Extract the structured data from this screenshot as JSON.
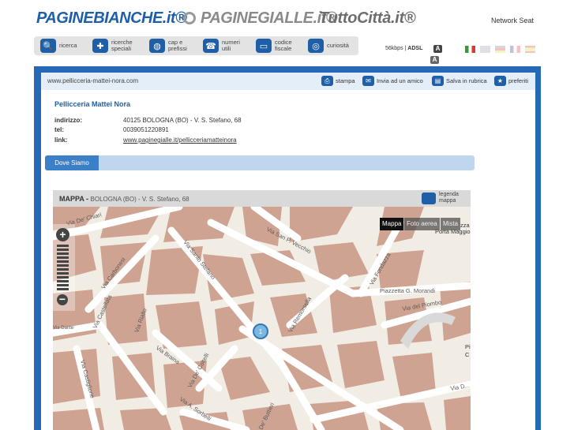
{
  "logos": {
    "paginebianche": "PAGINEBIANCHE.it®",
    "paginegialle": "PAGINEGIALLE.it®",
    "tuttocitta": "TuttoCittà.it®"
  },
  "network_link": "Network Seat",
  "nav": [
    {
      "label": "ricerca",
      "icon": "search-icon"
    },
    {
      "label": "ricerche\nspeciali",
      "icon": "puzzle-icon"
    },
    {
      "label": "cap e\nprefissi",
      "icon": "globe-icon"
    },
    {
      "label": "numeri\nutili",
      "icon": "phone-icon"
    },
    {
      "label": "codice\nfiscale",
      "icon": "id-card-icon"
    },
    {
      "label": "curiosità",
      "icon": "curiosity-icon"
    }
  ],
  "speed": {
    "text": "56kbps",
    "adsl": "ADSL",
    "badge": "A"
  },
  "url": "www.pellicceria-mattei-nora.com",
  "tools": {
    "print": "stampa",
    "send": "Invia ad un amico",
    "save": "Salva in rubrica",
    "favorites": "preferiti"
  },
  "business": {
    "name": "Pellicceria Mattei Nora",
    "address_label": "indirizzo:",
    "address": "40125 BOLOGNA (BO) - V. S. Stefano, 68",
    "tel_label": "tel:",
    "tel": "0039051220891",
    "link_label": "link:",
    "link": "www.paginegialle.it/pellicceriamatteinora"
  },
  "tab_label": "Dove Siamo",
  "map": {
    "title": "MAPPA -",
    "address": "BOLOGNA (BO) - V. S. Stefano, 68",
    "legend": "legenda\nmappa",
    "types": [
      "Mappa",
      "Foto aerea",
      "Mista"
    ],
    "marker": "1",
    "streets": {
      "chiari": "Via De' Chiari",
      "carbonesi": "Via Carbonesi",
      "castellata": "Via Castellata",
      "rialto": "Via Rialto",
      "santo_stefano": "Via Santo Stefano",
      "san_petronio": "Via San P. Vecchio",
      "fondazza": "Via Fondazza",
      "morandi": "Piazzetta G. Morandi",
      "piombo": "Via del Piombo",
      "remorsella": "Via Remorsella",
      "braina": "Via Braina",
      "castiglione": "Via Castiglione",
      "coltelli": "Via De' Coltelli",
      "sorbelli": "Via A. Sorbelli",
      "buttieri": "De' Buttieri",
      "dante": "Via Dante",
      "via_d": "Via D...",
      "porta": "Porta Maggio",
      "piazza": "zza",
      "pi": "Pi",
      "c": "C"
    }
  }
}
